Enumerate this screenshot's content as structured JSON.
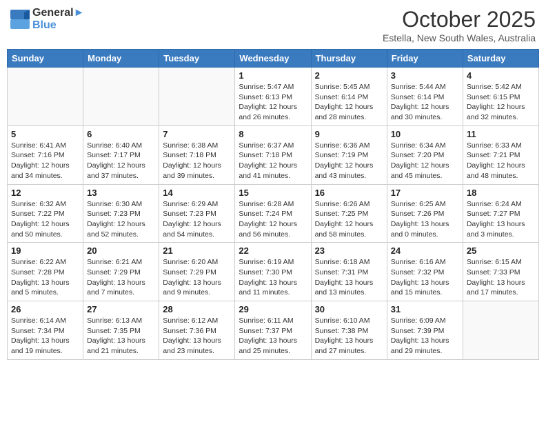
{
  "header": {
    "logo_line1": "General",
    "logo_line2": "Blue",
    "month": "October 2025",
    "location": "Estella, New South Wales, Australia"
  },
  "weekdays": [
    "Sunday",
    "Monday",
    "Tuesday",
    "Wednesday",
    "Thursday",
    "Friday",
    "Saturday"
  ],
  "weeks": [
    [
      {
        "day": "",
        "info": ""
      },
      {
        "day": "",
        "info": ""
      },
      {
        "day": "",
        "info": ""
      },
      {
        "day": "1",
        "info": "Sunrise: 5:47 AM\nSunset: 6:13 PM\nDaylight: 12 hours\nand 26 minutes."
      },
      {
        "day": "2",
        "info": "Sunrise: 5:45 AM\nSunset: 6:14 PM\nDaylight: 12 hours\nand 28 minutes."
      },
      {
        "day": "3",
        "info": "Sunrise: 5:44 AM\nSunset: 6:14 PM\nDaylight: 12 hours\nand 30 minutes."
      },
      {
        "day": "4",
        "info": "Sunrise: 5:42 AM\nSunset: 6:15 PM\nDaylight: 12 hours\nand 32 minutes."
      }
    ],
    [
      {
        "day": "5",
        "info": "Sunrise: 6:41 AM\nSunset: 7:16 PM\nDaylight: 12 hours\nand 34 minutes."
      },
      {
        "day": "6",
        "info": "Sunrise: 6:40 AM\nSunset: 7:17 PM\nDaylight: 12 hours\nand 37 minutes."
      },
      {
        "day": "7",
        "info": "Sunrise: 6:38 AM\nSunset: 7:18 PM\nDaylight: 12 hours\nand 39 minutes."
      },
      {
        "day": "8",
        "info": "Sunrise: 6:37 AM\nSunset: 7:18 PM\nDaylight: 12 hours\nand 41 minutes."
      },
      {
        "day": "9",
        "info": "Sunrise: 6:36 AM\nSunset: 7:19 PM\nDaylight: 12 hours\nand 43 minutes."
      },
      {
        "day": "10",
        "info": "Sunrise: 6:34 AM\nSunset: 7:20 PM\nDaylight: 12 hours\nand 45 minutes."
      },
      {
        "day": "11",
        "info": "Sunrise: 6:33 AM\nSunset: 7:21 PM\nDaylight: 12 hours\nand 48 minutes."
      }
    ],
    [
      {
        "day": "12",
        "info": "Sunrise: 6:32 AM\nSunset: 7:22 PM\nDaylight: 12 hours\nand 50 minutes."
      },
      {
        "day": "13",
        "info": "Sunrise: 6:30 AM\nSunset: 7:23 PM\nDaylight: 12 hours\nand 52 minutes."
      },
      {
        "day": "14",
        "info": "Sunrise: 6:29 AM\nSunset: 7:23 PM\nDaylight: 12 hours\nand 54 minutes."
      },
      {
        "day": "15",
        "info": "Sunrise: 6:28 AM\nSunset: 7:24 PM\nDaylight: 12 hours\nand 56 minutes."
      },
      {
        "day": "16",
        "info": "Sunrise: 6:26 AM\nSunset: 7:25 PM\nDaylight: 12 hours\nand 58 minutes."
      },
      {
        "day": "17",
        "info": "Sunrise: 6:25 AM\nSunset: 7:26 PM\nDaylight: 13 hours\nand 0 minutes."
      },
      {
        "day": "18",
        "info": "Sunrise: 6:24 AM\nSunset: 7:27 PM\nDaylight: 13 hours\nand 3 minutes."
      }
    ],
    [
      {
        "day": "19",
        "info": "Sunrise: 6:22 AM\nSunset: 7:28 PM\nDaylight: 13 hours\nand 5 minutes."
      },
      {
        "day": "20",
        "info": "Sunrise: 6:21 AM\nSunset: 7:29 PM\nDaylight: 13 hours\nand 7 minutes."
      },
      {
        "day": "21",
        "info": "Sunrise: 6:20 AM\nSunset: 7:29 PM\nDaylight: 13 hours\nand 9 minutes."
      },
      {
        "day": "22",
        "info": "Sunrise: 6:19 AM\nSunset: 7:30 PM\nDaylight: 13 hours\nand 11 minutes."
      },
      {
        "day": "23",
        "info": "Sunrise: 6:18 AM\nSunset: 7:31 PM\nDaylight: 13 hours\nand 13 minutes."
      },
      {
        "day": "24",
        "info": "Sunrise: 6:16 AM\nSunset: 7:32 PM\nDaylight: 13 hours\nand 15 minutes."
      },
      {
        "day": "25",
        "info": "Sunrise: 6:15 AM\nSunset: 7:33 PM\nDaylight: 13 hours\nand 17 minutes."
      }
    ],
    [
      {
        "day": "26",
        "info": "Sunrise: 6:14 AM\nSunset: 7:34 PM\nDaylight: 13 hours\nand 19 minutes."
      },
      {
        "day": "27",
        "info": "Sunrise: 6:13 AM\nSunset: 7:35 PM\nDaylight: 13 hours\nand 21 minutes."
      },
      {
        "day": "28",
        "info": "Sunrise: 6:12 AM\nSunset: 7:36 PM\nDaylight: 13 hours\nand 23 minutes."
      },
      {
        "day": "29",
        "info": "Sunrise: 6:11 AM\nSunset: 7:37 PM\nDaylight: 13 hours\nand 25 minutes."
      },
      {
        "day": "30",
        "info": "Sunrise: 6:10 AM\nSunset: 7:38 PM\nDaylight: 13 hours\nand 27 minutes."
      },
      {
        "day": "31",
        "info": "Sunrise: 6:09 AM\nSunset: 7:39 PM\nDaylight: 13 hours\nand 29 minutes."
      },
      {
        "day": "",
        "info": ""
      }
    ]
  ]
}
